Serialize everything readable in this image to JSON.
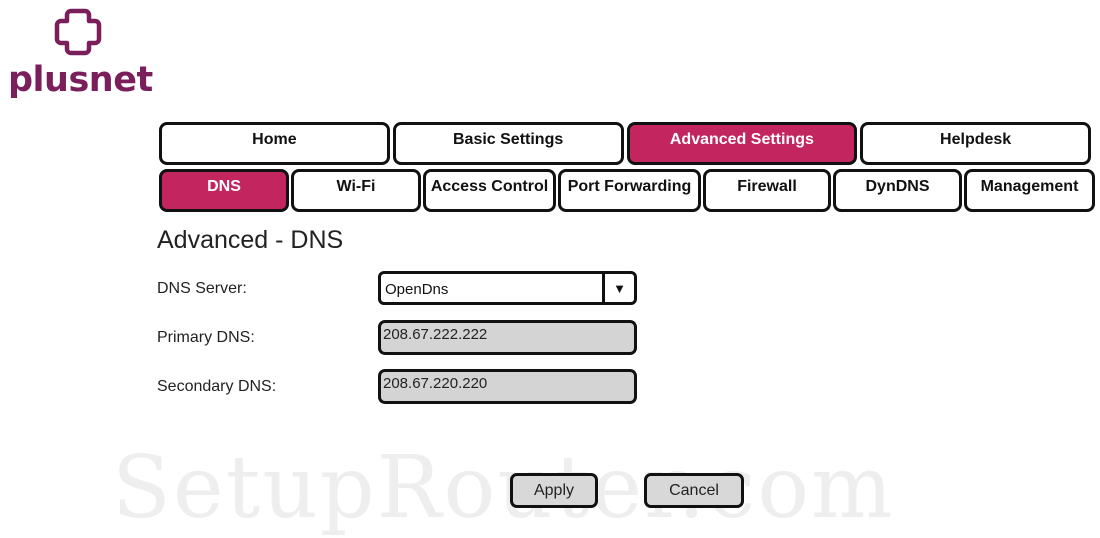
{
  "brand": {
    "name": "plusnet",
    "color": "#7a1f5c",
    "logo_icon": "plus-cross-icon"
  },
  "colors": {
    "active_tab": "#c3265f",
    "field_bg": "#d4d4d4"
  },
  "nav": {
    "top_tabs": [
      {
        "label": "Home",
        "active": false
      },
      {
        "label": "Basic Settings",
        "active": false
      },
      {
        "label": "Advanced Settings",
        "active": true
      },
      {
        "label": "Helpdesk",
        "active": false
      }
    ],
    "sub_tabs": [
      {
        "label": "DNS",
        "active": true
      },
      {
        "label": "Wi-Fi",
        "active": false
      },
      {
        "label": "Access Control",
        "active": false
      },
      {
        "label": "Port Forwarding",
        "active": false
      },
      {
        "label": "Firewall",
        "active": false
      },
      {
        "label": "DynDNS",
        "active": false
      },
      {
        "label": "Management",
        "active": false
      }
    ]
  },
  "page": {
    "title": "Advanced - DNS"
  },
  "form": {
    "dns_server_label": "DNS Server:",
    "dns_server_value": "OpenDns",
    "primary_label": "Primary DNS:",
    "primary_value": "208.67.222.222",
    "secondary_label": "Secondary DNS:",
    "secondary_value": "208.67.220.220"
  },
  "buttons": {
    "apply": "Apply",
    "cancel": "Cancel"
  },
  "watermark": "SetupRouter.com"
}
